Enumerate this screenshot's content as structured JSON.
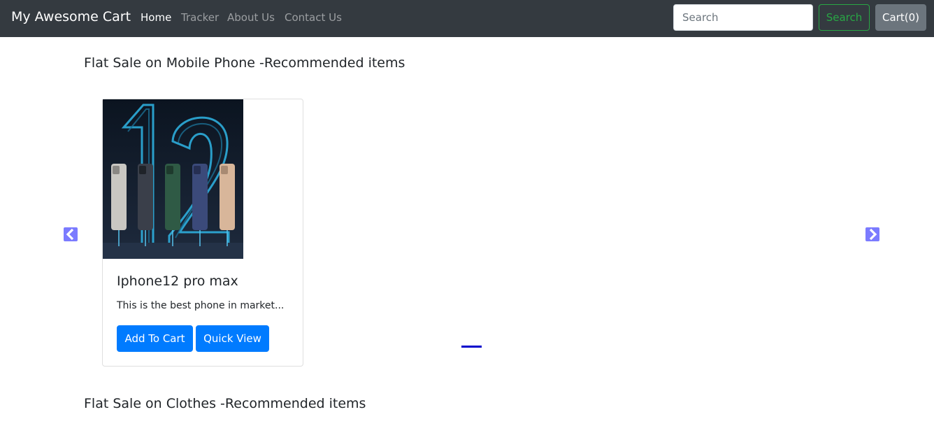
{
  "navbar": {
    "brand": "My Awesome Cart",
    "links": [
      {
        "label": "Home",
        "active": true
      },
      {
        "label": "Tracker",
        "active": false
      },
      {
        "label": "About Us",
        "active": false
      },
      {
        "label": "Contact Us",
        "active": false
      }
    ],
    "search_placeholder": "Search",
    "search_button": "Search",
    "cart_button": "Cart(0)"
  },
  "sections": [
    {
      "title": "Flat Sale on Mobile Phone -Recommended items",
      "products": [
        {
          "name": "Iphone12 pro max",
          "description": "This is the best phone in market...",
          "add_to_cart": "Add To Cart",
          "quick_view": "Quick View"
        }
      ]
    },
    {
      "title": "Flat Sale on Clothes -Recommended items",
      "products": []
    }
  ],
  "icons": {
    "prev": "chevron-left-icon",
    "next": "chevron-right-icon"
  },
  "colors": {
    "navbar_bg": "#343a40",
    "primary": "#007bff",
    "success": "#28a745",
    "secondary": "#6c757d",
    "carousel_arrow": "#7b7bff",
    "indicator": "#0000cc"
  }
}
